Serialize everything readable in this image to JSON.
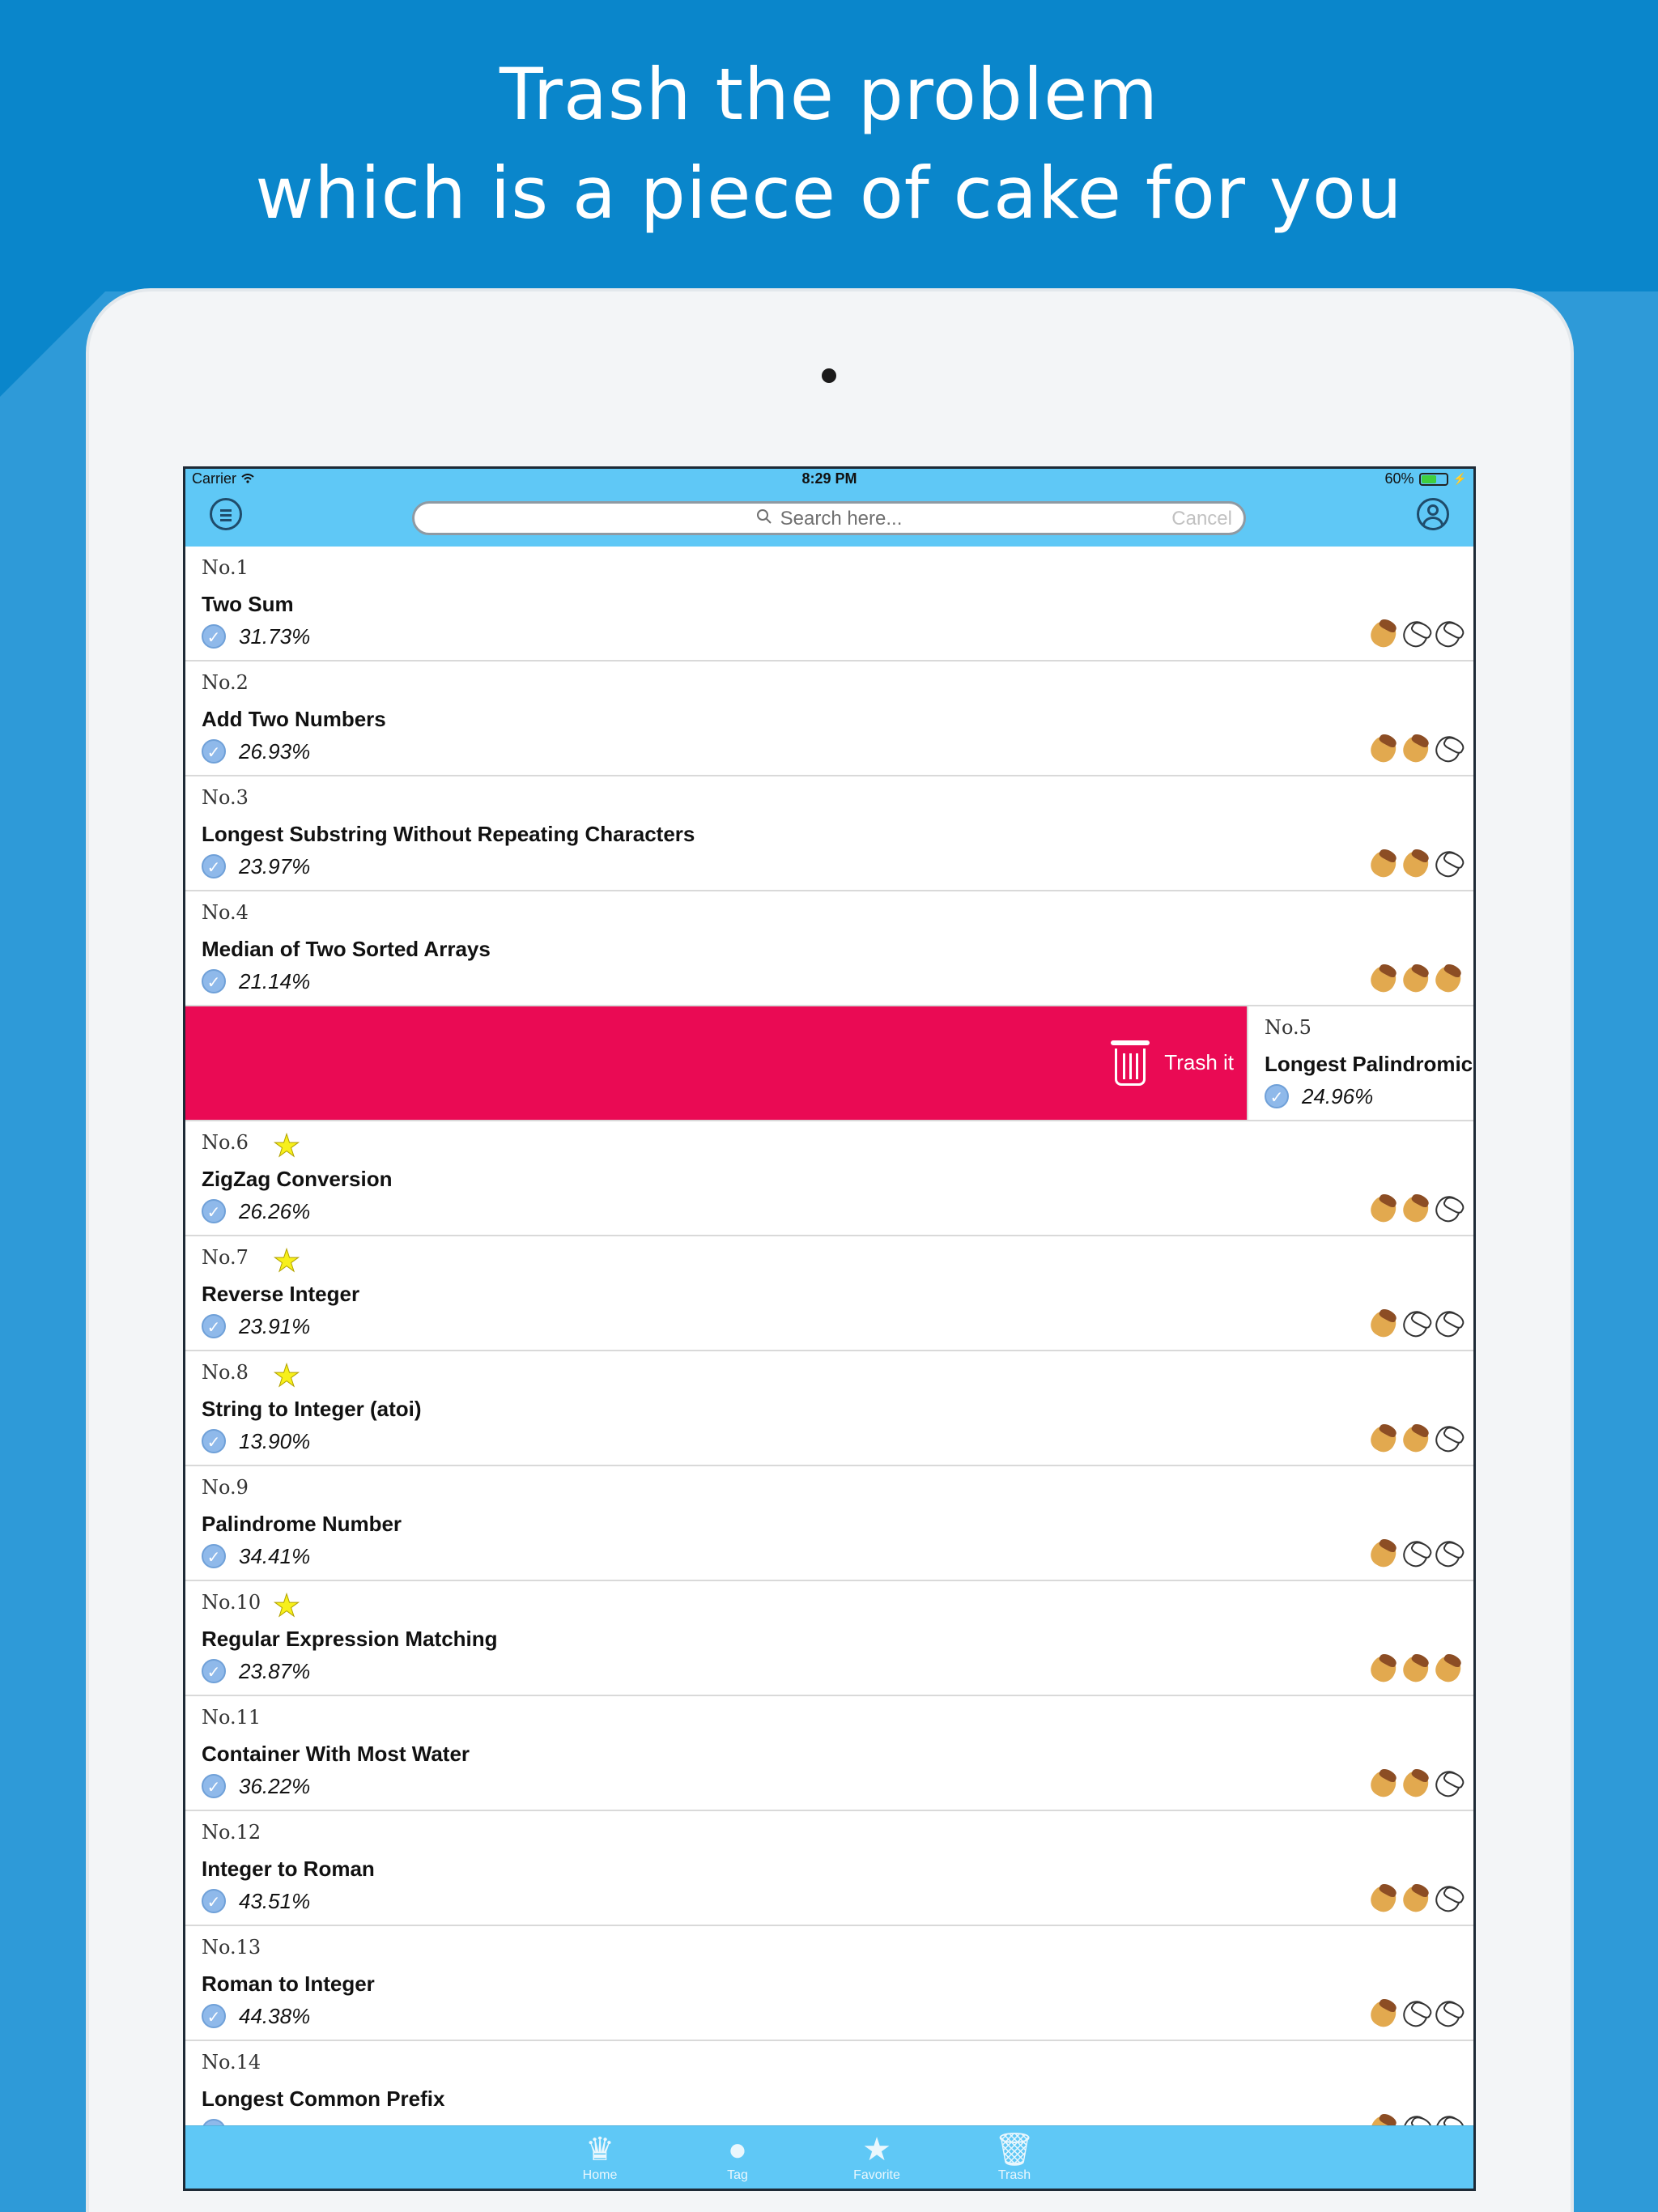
{
  "headline": {
    "line1": "Trash the problem",
    "line2": "which is a piece of cake for you"
  },
  "statusbar": {
    "carrier": "Carrier",
    "wifi_icon": "wifi-icon",
    "time": "8:29 PM",
    "battery": "60%",
    "battery_level": 0.6,
    "charging_icon": "bolt-icon"
  },
  "navbar": {
    "menu_icon": "menu-icon",
    "search_placeholder": "Search here...",
    "cancel": "Cancel",
    "profile_icon": "user-icon"
  },
  "problems": [
    {
      "num": "No.1",
      "title": "Two Sum",
      "rate": "31.73%",
      "star": false,
      "difficulty": 1
    },
    {
      "num": "No.2",
      "title": "Add Two Numbers",
      "rate": "26.93%",
      "star": false,
      "difficulty": 2
    },
    {
      "num": "No.3",
      "title": "Longest Substring Without Repeating Characters",
      "rate": "23.97%",
      "star": false,
      "difficulty": 2
    },
    {
      "num": "No.4",
      "title": "Median of Two Sorted Arrays",
      "rate": "21.14%",
      "star": false,
      "difficulty": 3
    },
    {
      "num": "No.6",
      "title": "ZigZag Conversion",
      "rate": "26.26%",
      "star": true,
      "difficulty": 2
    },
    {
      "num": "No.7",
      "title": "Reverse Integer",
      "rate": "23.91%",
      "star": true,
      "difficulty": 1
    },
    {
      "num": "No.8",
      "title": "String to Integer (atoi)",
      "rate": "13.90%",
      "star": true,
      "difficulty": 2
    },
    {
      "num": "No.9",
      "title": "Palindrome Number",
      "rate": "34.41%",
      "star": false,
      "difficulty": 1
    },
    {
      "num": "No.10",
      "title": "Regular Expression Matching",
      "rate": "23.87%",
      "star": true,
      "difficulty": 3
    },
    {
      "num": "No.11",
      "title": "Container With Most Water",
      "rate": "36.22%",
      "star": false,
      "difficulty": 2
    },
    {
      "num": "No.12",
      "title": "Integer to Roman",
      "rate": "43.51%",
      "star": false,
      "difficulty": 2
    },
    {
      "num": "No.13",
      "title": "Roman to Integer",
      "rate": "44.38%",
      "star": false,
      "difficulty": 1
    },
    {
      "num": "No.14",
      "title": "Longest Common Prefix",
      "rate": "",
      "star": false,
      "difficulty": 1
    }
  ],
  "swiped_row": {
    "num": "No.5",
    "title": "Longest Palindromic",
    "rate": "24.96%",
    "action_label": "Trash it",
    "action_icon": "trash-icon",
    "action_color": "#ea0a54"
  },
  "tabbar": {
    "tabs": [
      {
        "label": "Home",
        "icon": "home-icon",
        "glyph": "♛"
      },
      {
        "label": "Tag",
        "icon": "tag-icon",
        "glyph": "●"
      },
      {
        "label": "Favorite",
        "icon": "star-icon",
        "glyph": "★"
      },
      {
        "label": "Trash",
        "icon": "trash-icon",
        "glyph": "🗑"
      }
    ]
  },
  "colors": {
    "background": "#0a86cb",
    "bar": "#5fc8f6",
    "trash": "#ea0a54"
  }
}
